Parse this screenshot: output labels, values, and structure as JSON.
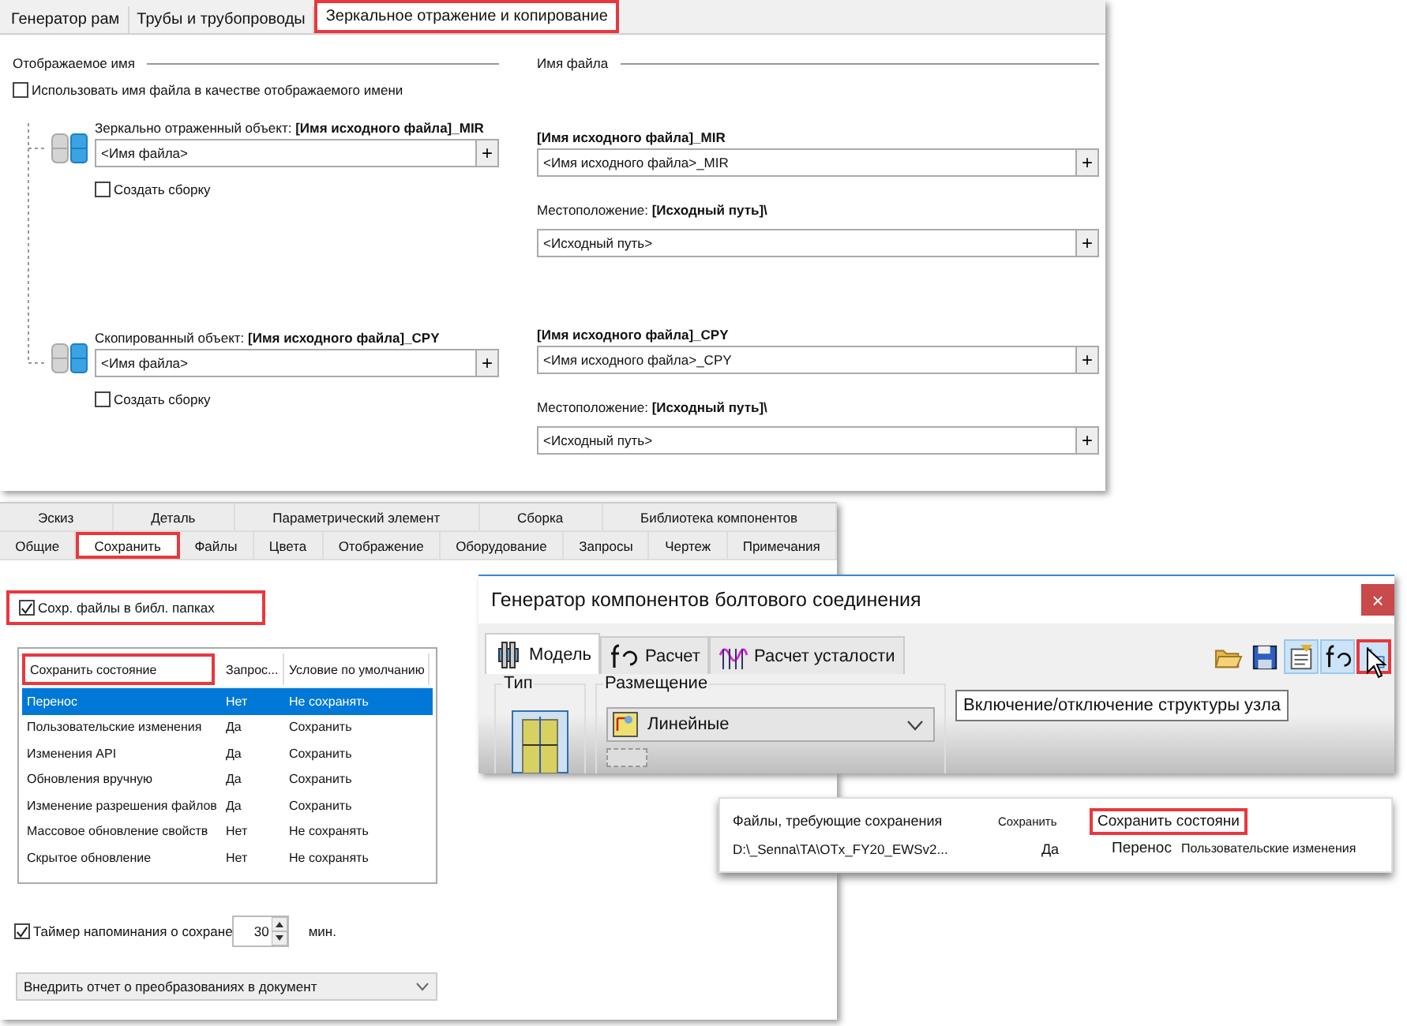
{
  "mirror_panel": {
    "tabs": [
      {
        "label": "Генератор рам",
        "selected": false,
        "highlighted": false
      },
      {
        "label": "Трубы и трубопроводы",
        "selected": false,
        "highlighted": false
      },
      {
        "label": "Зеркальное отражение и копирование",
        "selected": true,
        "highlighted": true
      }
    ],
    "display_name": {
      "heading": "Отображаемое имя",
      "use_file_name": {
        "label": "Использовать имя файла в качестве отображаемого имени",
        "checked": false
      },
      "objects": [
        {
          "label": "Зеркально отраженный объект: **[Имя исходного файла]_MIR**",
          "field": "<Имя файла>",
          "plus": "+",
          "assembly": {
            "label": "Создать сборку",
            "checked": false
          }
        },
        {
          "label": "Скопированный объект: **[Имя исходного файла]_CPY**",
          "field": "<Имя файла>",
          "plus": "+",
          "assembly": {
            "label": "Создать сборку",
            "checked": false
          }
        }
      ]
    },
    "file_name": {
      "heading": "Имя файла",
      "entries": [
        {
          "name": "[Имя исходного файла]_MIR",
          "field": "<Имя исходного файла>_MIR",
          "plus": "+",
          "location": {
            "label": "Местоположение: **[Исходный путь]\\**",
            "field": "<Исходный путь>",
            "plus": "+"
          }
        },
        {
          "name": "[Имя исходного файла]_CPY",
          "field": "<Имя исходного файла>_CPY",
          "plus": "+",
          "location": {
            "label": "Местоположение: **[Исходный путь]\\**",
            "field": "<Исходный путь>",
            "plus": "+"
          }
        }
      ]
    }
  },
  "options_panel": {
    "tab_rows": [
      [
        {
          "label": "Эскиз",
          "selected": false,
          "highlighted": false
        },
        {
          "label": "Деталь",
          "selected": false,
          "highlighted": false
        },
        {
          "label": "Параметрический элемент",
          "selected": false,
          "highlighted": false
        },
        {
          "label": "Сборка",
          "selected": false,
          "highlighted": false
        },
        {
          "label": "Библиотека компонентов",
          "selected": false,
          "highlighted": false
        }
      ],
      [
        {
          "label": "Общие",
          "selected": false,
          "highlighted": false
        },
        {
          "label": "Сохранить",
          "selected": true,
          "highlighted": true
        },
        {
          "label": "Файлы",
          "selected": false,
          "highlighted": false
        },
        {
          "label": "Цвета",
          "selected": false,
          "highlighted": false
        },
        {
          "label": "Отображение",
          "selected": false,
          "highlighted": false
        },
        {
          "label": "Оборудование",
          "selected": false,
          "highlighted": false
        },
        {
          "label": "Запросы",
          "selected": false,
          "highlighted": false
        },
        {
          "label": "Чертеж",
          "selected": false,
          "highlighted": false
        },
        {
          "label": "Примечания",
          "selected": false,
          "highlighted": false
        }
      ]
    ],
    "save_to_library": {
      "label": "Сохр. файлы в библ. папках",
      "checked": true,
      "highlighted": true
    },
    "table": {
      "columns": [
        {
          "label": "Сохранить состояние",
          "highlighted": true
        },
        {
          "label": "Запрос...",
          "highlighted": false
        },
        {
          "label": "Условие по умолчанию",
          "highlighted": false
        }
      ],
      "rows": [
        {
          "cells": [
            "Перенос",
            "Нет",
            "Не сохранять"
          ],
          "selected": true
        },
        {
          "cells": [
            "Пользовательские изменения",
            "Да",
            "Сохранить"
          ],
          "selected": false
        },
        {
          "cells": [
            "Изменения API",
            "Да",
            "Сохранить"
          ],
          "selected": false
        },
        {
          "cells": [
            "Обновления вручную",
            "Да",
            "Сохранить"
          ],
          "selected": false
        },
        {
          "cells": [
            "Изменение разрешения файлов",
            "Да",
            "Сохранить"
          ],
          "selected": false
        },
        {
          "cells": [
            "Массовое обновление свойств",
            "Нет",
            "Не сохранять"
          ],
          "selected": false
        },
        {
          "cells": [
            "Скрытое обновление",
            "Нет",
            "Не сохранять"
          ],
          "selected": false
        }
      ]
    },
    "reminder": {
      "label": "Таймер напоминания о сохране",
      "checked": true,
      "value": "30",
      "unit": "мин."
    },
    "report_dropdown": {
      "value": "Внедрить отчет о преобразованиях в документ"
    }
  },
  "bolt_dialog": {
    "title": "Генератор компонентов болтового соединения",
    "close": "×",
    "tabs": [
      {
        "label": "Модель",
        "selected": true,
        "kind": "model"
      },
      {
        "label": "Расчет",
        "selected": false,
        "kind": "calc"
      },
      {
        "label": "Расчет усталости",
        "selected": false,
        "kind": "fatigue"
      }
    ],
    "toolbar": [
      {
        "kind": "open",
        "pressed": false,
        "highlighted": false
      },
      {
        "kind": "save",
        "pressed": false,
        "highlighted": false
      },
      {
        "kind": "properties",
        "pressed": true,
        "highlighted": false
      },
      {
        "kind": "formula",
        "pressed": true,
        "highlighted": false
      },
      {
        "kind": "structure",
        "pressed": true,
        "highlighted": true
      }
    ],
    "type_group": {
      "label": "Тип"
    },
    "placement_group": {
      "label": "Размещение",
      "dropdown": "Линейные"
    },
    "tooltip": "Включение/отключение структуры узла"
  },
  "save_popup": {
    "columns": [
      {
        "label": "Файлы, требующие сохранения",
        "highlighted": false
      },
      {
        "label": "Сохранить",
        "highlighted": false
      },
      {
        "label": "Сохранить состояни",
        "highlighted": true
      }
    ],
    "row": [
      "D:\\_Senna\\TA\\OTx_FY20_EWSv2...",
      "Да",
      "Перенос",
      "Пользовательские изменения"
    ]
  }
}
